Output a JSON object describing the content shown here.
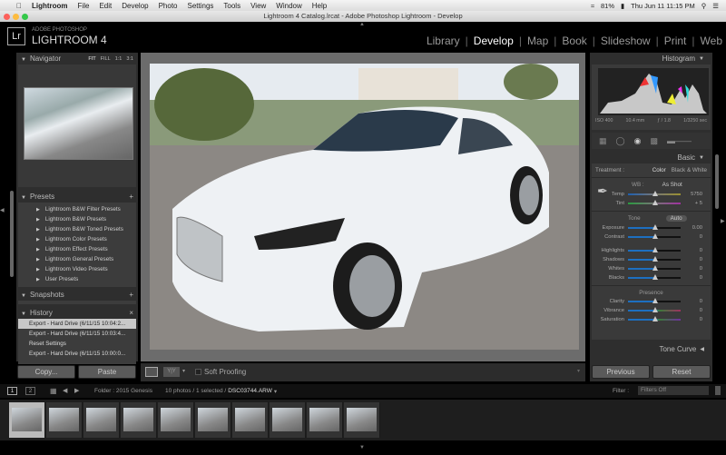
{
  "menubar": {
    "app": "Lightroom",
    "items": [
      "File",
      "Edit",
      "Develop",
      "Photo",
      "Settings",
      "Tools",
      "View",
      "Window",
      "Help"
    ],
    "battery": "81%",
    "datetime": "Thu Jun 11  11:15 PM"
  },
  "window": {
    "title": "Lightroom 4 Catalog.lrcat - Adobe Photoshop Lightroom - Develop"
  },
  "brand": {
    "logo": "Lr",
    "adobe": "ADOBE PHOTOSHOP",
    "product": "LIGHTROOM 4"
  },
  "modules": [
    {
      "label": "Library"
    },
    {
      "label": "Develop",
      "active": true
    },
    {
      "label": "Map"
    },
    {
      "label": "Book"
    },
    {
      "label": "Slideshow"
    },
    {
      "label": "Print"
    },
    {
      "label": "Web"
    }
  ],
  "navigator": {
    "title": "Navigator",
    "zoom": [
      "FIT",
      "FILL",
      "1:1",
      "3:1"
    ]
  },
  "presets": {
    "title": "Presets",
    "items": [
      "Lightroom B&W Filter Presets",
      "Lightroom B&W Presets",
      "Lightroom B&W Toned Presets",
      "Lightroom Color Presets",
      "Lightroom Effect Presets",
      "Lightroom General Presets",
      "Lightroom Video Presets",
      "User Presets"
    ]
  },
  "snapshots": {
    "title": "Snapshots"
  },
  "history": {
    "title": "History",
    "items": [
      "Export - Hard Drive (6/11/15 10:04:2...",
      "Export - Hard Drive (6/11/15 10:03:4...",
      "Reset Settings",
      "Export - Hard Drive (6/11/15 10:00:0..."
    ]
  },
  "left_buttons": {
    "copy": "Copy...",
    "paste": "Paste"
  },
  "toolbar": {
    "soft_proofing": "Soft Proofing",
    "yy": "Y|Y"
  },
  "histogram": {
    "title": "Histogram",
    "iso": "ISO 400",
    "focal": "10.4 mm",
    "aperture": "ƒ / 1.8",
    "shutter": "1/3250 sec"
  },
  "basic": {
    "title": "Basic",
    "treatment_label": "Treatment :",
    "color": "Color",
    "bw": "Black & White",
    "wb_label": "WB :",
    "wb_value": "As Shot",
    "tone_label": "Tone",
    "auto": "Auto",
    "presence_label": "Presence",
    "wb_sliders": [
      {
        "label": "Temp",
        "value": "5750"
      },
      {
        "label": "Tint",
        "value": "+ 5"
      }
    ],
    "tone_sliders": [
      {
        "label": "Exposure",
        "value": "0.00"
      },
      {
        "label": "Contrast",
        "value": "0"
      }
    ],
    "tone2_sliders": [
      {
        "label": "Highlights",
        "value": "0"
      },
      {
        "label": "Shadows",
        "value": "0"
      },
      {
        "label": "Whites",
        "value": "0"
      },
      {
        "label": "Blacks",
        "value": "0"
      }
    ],
    "presence_sliders": [
      {
        "label": "Clarity",
        "value": "0"
      },
      {
        "label": "Vibrance",
        "value": "0"
      },
      {
        "label": "Saturation",
        "value": "0"
      }
    ]
  },
  "tone_curve": {
    "title": "Tone Curve"
  },
  "right_buttons": {
    "previous": "Previous",
    "reset": "Reset"
  },
  "filmstrip": {
    "page1": "1",
    "page2": "2",
    "folder": "Folder : 2015 Genesis",
    "count": "10 photos / 1 selected /",
    "file": "DSC03744.ARW",
    "filter_label": "Filter :",
    "filter_value": "Filters Off",
    "thumbnails": 10,
    "selected_index": 0
  }
}
